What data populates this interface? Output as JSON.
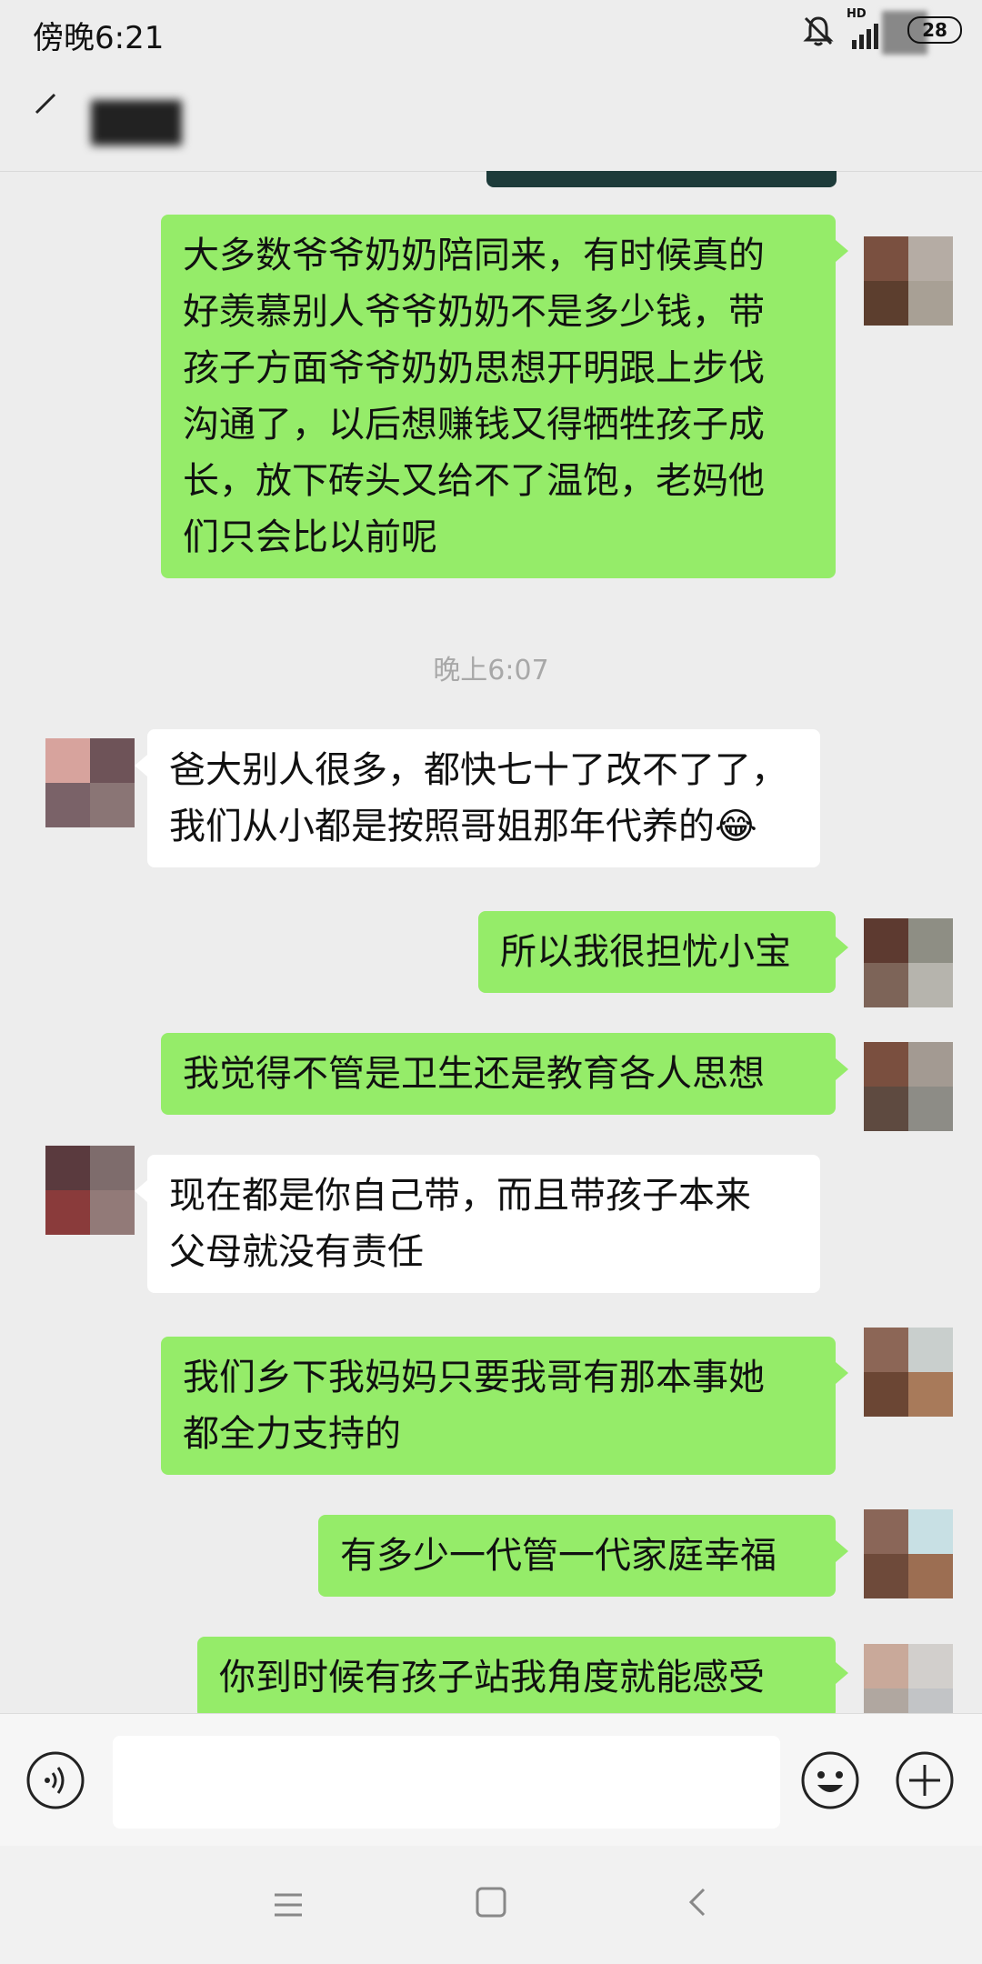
{
  "status": {
    "time": "傍晚6:21",
    "network": "HD",
    "battery": "28"
  },
  "header": {
    "back_icon": "back-arrow-icon"
  },
  "messages": [
    {
      "side": "me",
      "text": "大多数爷爷奶奶陪同来，有时候真的\n好羡慕别人爷爷奶奶不是多少钱，带\n孩子方面爷爷奶奶思想开明跟上步伐\n沟通了，以后想赚钱又得牺牲孩子成\n长，放下砖头又给不了温饱，老妈他\n们只会比以前呢"
    },
    {
      "side": "time",
      "text": "晚上6:07"
    },
    {
      "side": "them",
      "text": "爸大别人很多，都快七十了改不了了，\n我们从小都是按照哥姐那年代养的😂"
    },
    {
      "side": "me",
      "text": "所以我很担忧小宝"
    },
    {
      "side": "me",
      "text": "我觉得不管是卫生还是教育各人思想"
    },
    {
      "side": "them",
      "text": "现在都是你自己带，而且带孩子本来\n父母就没有责任"
    },
    {
      "side": "me",
      "text": "我们乡下我妈妈只要我哥有那本事她\n都全力支持的"
    },
    {
      "side": "me",
      "text": "有多少一代管一代家庭幸福"
    },
    {
      "side": "me",
      "text": "你到时候有孩子站我角度就能感受"
    }
  ],
  "colors": {
    "my_bubble": "#95ec69",
    "their_bubble": "#ffffff",
    "background": "#ededed"
  },
  "inputbar": {
    "voice_icon": "voice-icon",
    "emoji_icon": "emoji-icon",
    "plus_icon": "plus-icon"
  },
  "navbar": {
    "menu_icon": "menu-icon",
    "home_icon": "home-icon",
    "back_icon": "back-icon"
  }
}
